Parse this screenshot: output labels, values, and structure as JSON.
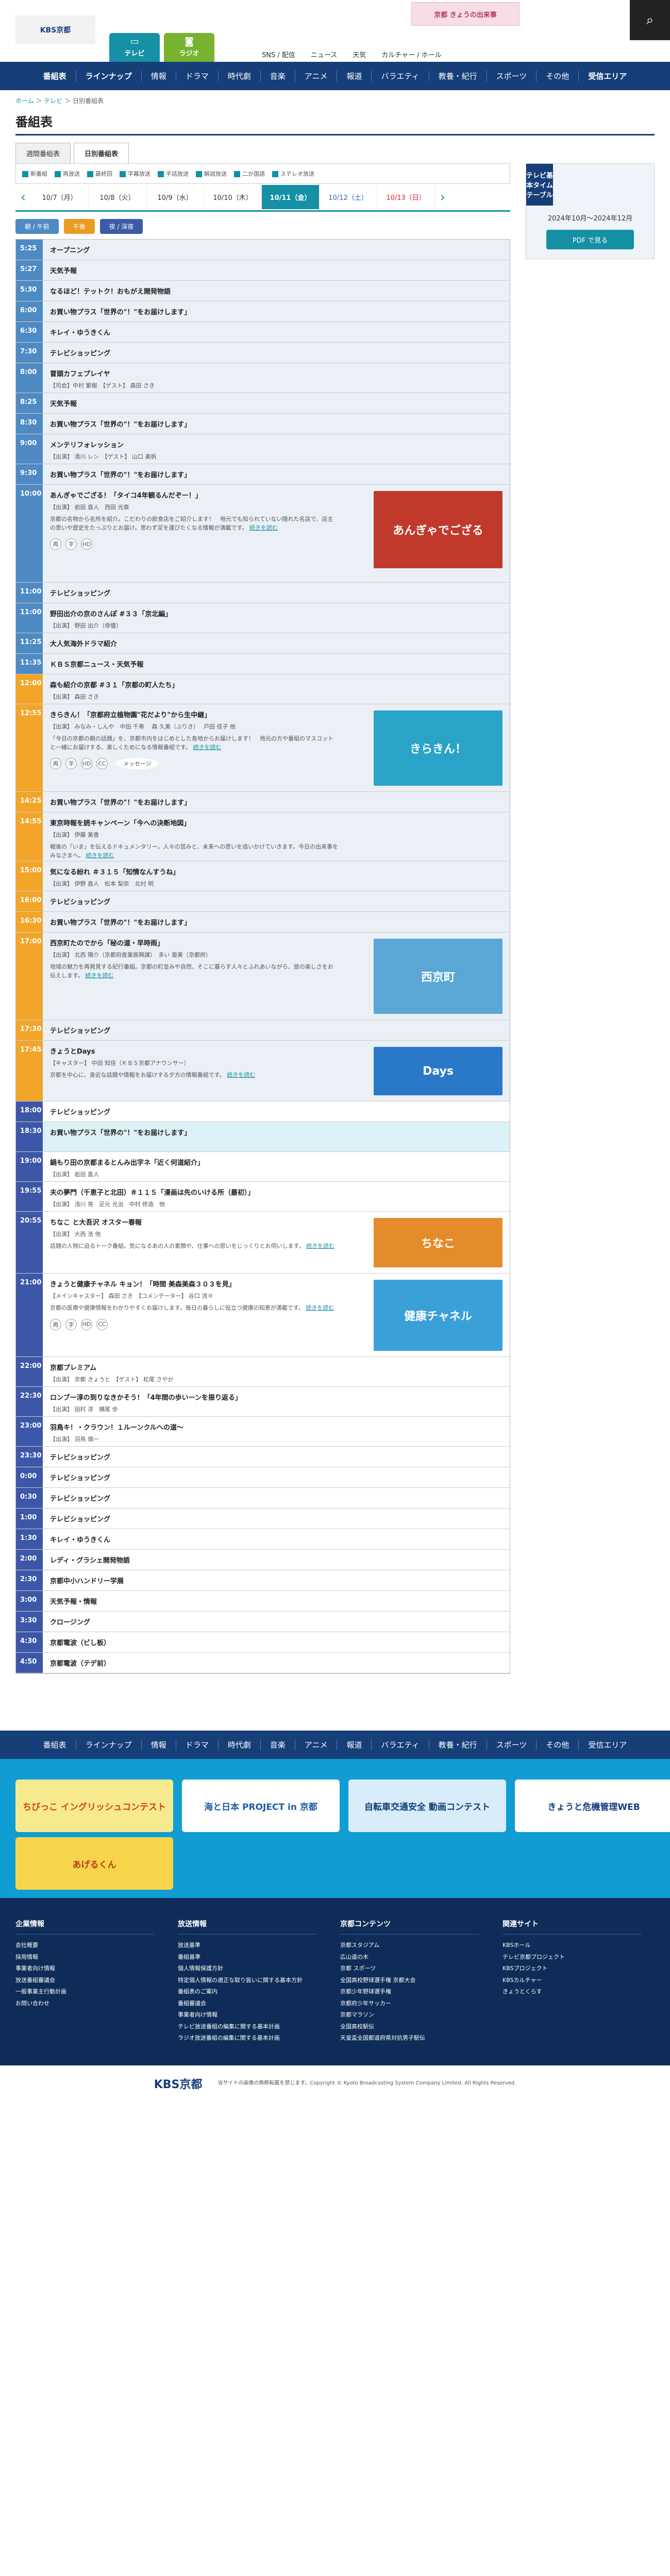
{
  "header": {
    "logo": "KBS京都",
    "banner": "京都 きょうの出来事",
    "nav": [
      "SNS / 配信",
      "ニュース",
      "天気",
      "カルチャー / ホール"
    ],
    "tv": "テレビ",
    "radio": "ラジオ",
    "search_icon": "search-icon"
  },
  "gnav": {
    "left": [
      "番組表",
      "ラインナップ"
    ],
    "items": [
      "情報",
      "ドラマ",
      "時代劇",
      "音楽",
      "アニメ",
      "報道",
      "バラエティ",
      "教養・紀行",
      "スポーツ",
      "その他"
    ],
    "right": "受信エリア"
  },
  "breadcrumb": {
    "home": "ホーム",
    "sep": " ＞ ",
    "tv": "テレビ",
    "page": "日別番組表"
  },
  "page_title": "番組表",
  "tabs": [
    "週間番組表",
    "日別番組表"
  ],
  "legend": [
    "新番組",
    "再放送",
    "最終回",
    "字幕放送",
    "手話放送",
    "解説放送",
    "二か国語",
    "ステレオ放送"
  ],
  "dates": [
    {
      "label": "10/7（月）",
      "cls": ""
    },
    {
      "label": "10/8（火）",
      "cls": ""
    },
    {
      "label": "10/9（水）",
      "cls": ""
    },
    {
      "label": "10/10（木）",
      "cls": ""
    },
    {
      "label": "10/11（金）",
      "cls": "on"
    },
    {
      "label": "10/12（土）",
      "cls": "sat"
    },
    {
      "label": "10/13（日）",
      "cls": "sun"
    }
  ],
  "timeofday": [
    "朝 / 午前",
    "午後",
    "夜 / 深夜"
  ],
  "sidebar": {
    "title": "テレビ基本タイムテーブル",
    "period": "2024年10月〜2024年12月",
    "pdf": "PDF で見る"
  },
  "programs": [
    {
      "time": "5:25",
      "title": "オープニング",
      "band": "mo",
      "h": 40
    },
    {
      "time": "5:27",
      "title": "天気予報",
      "band": "mo",
      "h": 40
    },
    {
      "time": "5:30",
      "title": "なるほど！テットク！おもがえ開発物語",
      "band": "mo",
      "h": 40
    },
    {
      "time": "6:00",
      "title": "お買い物プラス「世界の\"！\"をお届けします」",
      "band": "mo",
      "h": 40
    },
    {
      "time": "6:30",
      "title": "キレイ・ゆうきくん",
      "band": "mo",
      "h": 40
    },
    {
      "time": "7:30",
      "title": "テレビショッピング",
      "band": "mo",
      "h": 40
    },
    {
      "time": "8:00",
      "title": "冒頭カフェプレイヤ",
      "band": "mo",
      "h": 58,
      "cast": "【司会】中村 繁樹　【ゲスト】 森田 さき"
    },
    {
      "time": "8:25",
      "title": "天気予報",
      "band": "mo",
      "h": 40
    },
    {
      "time": "8:30",
      "title": "お買い物プラス「世界の\"！\"をお届けします」",
      "band": "mo",
      "h": 40
    },
    {
      "time": "9:00",
      "title": "メンテリフォレッション",
      "band": "mo",
      "h": 58,
      "cast": "【出演】 清川 レン　【ゲスト】 山口 美帆"
    },
    {
      "time": "9:30",
      "title": "お買い物プラス「世界の\"！\"をお届けします」",
      "band": "mo",
      "h": 40
    },
    {
      "time": "10:00",
      "title": "あんぎゃでござる！「タイコ4年観るんだぞー！」",
      "band": "mo",
      "h": 190,
      "cast": "【出演】 岩田 直人　西田 光章",
      "desc": "京都の名物から名所を紹介。こだわりの飲食店をご紹介します！　地元でも知られていない隠れた名店で、店主の思いや歴史をたっぷりとお届け。思わず足を運びたくなる情報が満載です。",
      "more": "続きを読む",
      "icons": [
        "再",
        "字",
        "HD"
      ],
      "thumb": "あんぎゃでござる",
      "thumbBg": "#c0392b"
    },
    {
      "time": "11:00",
      "title": "テレビショッピング",
      "band": "mo",
      "h": 40
    },
    {
      "time": "11:00",
      "title": "野田出介の京のさんぽ #３３「京北編」",
      "band": "mo",
      "h": 58,
      "cast": "【出演】 野田 出介（俳優）"
    },
    {
      "time": "11:25",
      "title": "大人気海外ドラマ紹介",
      "band": "mo",
      "h": 40
    },
    {
      "time": "11:35",
      "title": "ＫＢＳ京都ニュース・天気予報",
      "band": "mo",
      "h": 40
    },
    {
      "time": "12:00",
      "title": "森も紹介の京都 #３１「京都の町人たち」",
      "band": "da",
      "h": 58,
      "cast": "【出演】 森田 さき"
    },
    {
      "time": "12:55",
      "title": "きらきん！「京都府立植物園\"花だより\"から生中継」",
      "band": "da",
      "h": 170,
      "cast": "【出演】 みなみ・しんや　中田 千寿　 森 久美（ぶりき）　 戸田 佳子 他",
      "desc": "「今日の京都の朝の話題」を、京都市内をはじめとした各地からお届けします！　地元の方や番組のマスコットと一緒にお届けする、楽しくためになる情報番組です。",
      "more": "続きを読む",
      "icons": [
        "再",
        "字",
        "HD",
        "CC"
      ],
      "msg": "メッセージ",
      "thumb": "きらきん！",
      "thumbBg": "#2aa3c8"
    },
    {
      "time": "14:25",
      "title": "お買い物プラス「世界の\"！\"をお届けします」",
      "band": "da",
      "h": 40
    },
    {
      "time": "14:55",
      "title": "東京時報を読キャンペーン「今への決断地図」",
      "band": "da",
      "h": 95,
      "cast": "【出演】 伊藤 美香",
      "desc": "戦後の「いま」を伝えるドキュメンタリー。人々の営みと、未来への思いを追いかけていきます。今日の出来事をみなさまへ。",
      "more": "続きを読む"
    },
    {
      "time": "15:00",
      "title": "気になる紛れ ＃３１５「知情なんすうね」",
      "band": "da",
      "h": 58,
      "cast": "【出演】 伊野 直人　松本 梨奈　北村 明"
    },
    {
      "time": "16:00",
      "title": "テレビショッピング",
      "band": "da",
      "h": 40
    },
    {
      "time": "16:30",
      "title": "お買い物プラス「世界の\"！\"をお届けします」",
      "band": "da",
      "h": 40
    },
    {
      "time": "17:00",
      "title": "西京町たのでから「秘の道・早時雨」",
      "band": "da",
      "h": 170,
      "cast": "【出演】 北西 陽介（京都府産業振興課）　多い 亜美（京都府）",
      "desc": "地域の魅力を再発見する紀行番組。京都の町並みや自然、そこに暮らす人々とふれあいながら、旅の楽しさをお伝えします。",
      "more": "続きを読む",
      "thumb": "西京町",
      "thumbBg": "#5aa7d6"
    },
    {
      "time": "17:30",
      "title": "テレビショッピング",
      "band": "da",
      "h": 40
    },
    {
      "time": "17:45",
      "title": "きょうとDays",
      "band": "da",
      "h": 118,
      "cast": "【キャスター】 中田 知佳（ＫＢＳ京都アナウンサー）",
      "desc": "京都を中心に、身近な話題や情報をお届けする夕方の情報番組です。",
      "more": "続きを読む",
      "thumb": "Days",
      "thumbBg": "#2a79c9"
    },
    {
      "time": "18:00",
      "title": "テレビショッピング",
      "band": "ni",
      "h": 40
    },
    {
      "time": "18:30",
      "title": "お買い物プラス「世界の\"！\"をお届けします」",
      "band": "ni",
      "h": 58,
      "live": true
    },
    {
      "time": "19:00",
      "title": "鍋もり田の京都まるとんみ出字ネ「近く何道紹介」",
      "band": "ni",
      "h": 58,
      "cast": "【出演】 岩田 直人"
    },
    {
      "time": "19:55",
      "title": "夫の夢門（千恵子と北田）＃１１５「漫画は先のいける所（最初）」",
      "band": "ni",
      "h": 58,
      "cast": "【出演】 浅川 亮　足元 光治　中村 修造　他"
    },
    {
      "time": "20:55",
      "title": "ちなこ と大吾沢 オスター春報",
      "band": "ni",
      "h": 120,
      "cast": "【出演】 大西 浩 他",
      "desc": "話題の人物に迫るトーク番組。気になるあの人の素顔や、仕事への思いをじっくりとお伺いします。",
      "more": "続きを読む",
      "thumb": "ちなこ",
      "thumbBg": "#e48c2b"
    },
    {
      "time": "21:00",
      "title": "きょうと健康チャネル キョン！「時間 美森美森３０３を見」",
      "band": "ni",
      "h": 162,
      "cast": "【メインキャスター】 森田 さき　【コメンテーター】 谷口 流々",
      "desc": "京都の医療や健康情報をわかりやすくお届けします。毎日の暮らしに役立つ健康の知恵が満載です。",
      "more": "続きを読む",
      "icons": [
        "再",
        "字",
        "HD",
        "CC"
      ],
      "thumb": "健康チャネル",
      "thumbBg": "#3aa0d8"
    },
    {
      "time": "22:00",
      "title": "京都プレミアム",
      "band": "ni",
      "h": 58,
      "cast": "【出演】 京都 きょうと　【ゲスト】 松尾 さやか"
    },
    {
      "time": "22:30",
      "title": "ロンブー淳の到りなきかそう！「4年間の歩いーンを振り返る」",
      "band": "ni",
      "h": 58,
      "cast": "【出演】 田村 淳　横尾 歩"
    },
    {
      "time": "23:00",
      "title": "羽鳥キ！・クラウン！１ルーンクルへの道～",
      "band": "ni",
      "h": 58,
      "cast": "【出演】 羽鳥 慎一"
    },
    {
      "time": "23:30",
      "title": "テレビショッピング",
      "band": "ni",
      "h": 40
    },
    {
      "time": "0:00",
      "title": "テレビショッピング",
      "band": "ni",
      "h": 40
    },
    {
      "time": "0:30",
      "title": "テレビショッピング",
      "band": "ni",
      "h": 40
    },
    {
      "time": "1:00",
      "title": "テレビショッピング",
      "band": "ni",
      "h": 40
    },
    {
      "time": "1:30",
      "title": "キレイ・ゆうきくん",
      "band": "ni",
      "h": 40
    },
    {
      "time": "2:00",
      "title": "レディ・グラシェ開発物語",
      "band": "ni",
      "h": 40
    },
    {
      "time": "2:30",
      "title": "京都中小ハンドリー学展",
      "band": "ni",
      "h": 40
    },
    {
      "time": "3:00",
      "title": "天気予報・情報",
      "band": "ni",
      "h": 40
    },
    {
      "time": "3:30",
      "title": "クロージング",
      "band": "ni",
      "h": 40
    },
    {
      "time": "4:30",
      "title": "京都電波（ビし板）",
      "band": "ni",
      "h": 40
    },
    {
      "time": "4:50",
      "title": "京都電波（テデ前）",
      "band": "ni",
      "h": 40
    }
  ],
  "footer_nav": {
    "left": [
      "番組表",
      "ラインナップ"
    ],
    "items": [
      "情報",
      "ドラマ",
      "時代劇",
      "音楽",
      "アニメ",
      "報道",
      "バラエティ",
      "教養・紀行",
      "スポーツ",
      "その他"
    ],
    "right": "受信エリア"
  },
  "banners": [
    {
      "label": "ちびっこ イングリッシュコンテスト",
      "bg": "#f7e98d",
      "fg": "#d2421b"
    },
    {
      "label": "海と日本 PROJECT in 京都",
      "bg": "#ffffff",
      "fg": "#1e5ba8"
    },
    {
      "label": "自転車交通安全 動画コンテスト",
      "bg": "#d8ecf9",
      "fg": "#133e7a"
    },
    {
      "label": "きょうと危機管理WEB",
      "bg": "#ffffff",
      "fg": "#1b3c83"
    },
    {
      "label": "あげるくん",
      "bg": "#f7d54a",
      "fg": "#c03818"
    }
  ],
  "footer_cols": [
    {
      "title": "企業情報",
      "links": [
        "会社概要",
        "採用情報",
        "事業者向け情報",
        "放送番組審議会",
        "一般事業主行動計画",
        "お問い合わせ"
      ]
    },
    {
      "title": "放送情報",
      "links": [
        "放送基準",
        "番組基準",
        "個人情報保護方針",
        "特定個人情報の適正な取り扱いに関する基本方針",
        "番組表のご案内",
        "番組審議会",
        "事業者向け情報",
        "テレビ放送番組の編集に関する基本計画",
        "ラジオ放送番組の編集に関する基本計画"
      ]
    },
    {
      "title": "京都コンテンツ",
      "links": [
        "京都スタジアム",
        "広山道の木",
        "京都 スポーツ",
        "全国高校野球選手権 京都大会",
        "京都少年野球選手権",
        "京都府少年サッカー",
        "京都マラソン",
        "全国高校駅伝",
        "天皇盃全国都道府県対抗男子駅伝"
      ]
    },
    {
      "title": "関連サイト",
      "links": [
        "KBSホール",
        "テレビ京都プロジェクト",
        "KBSプロジェクト",
        "KBSカルチャー",
        "きょうとくらす"
      ]
    }
  ],
  "copyright": "当サイトの画像の無断転載を禁じます。Copyright © Kyoto Broadcasting System Company Limited. All Rights Reserved.",
  "footer_logo": "KBS京都"
}
